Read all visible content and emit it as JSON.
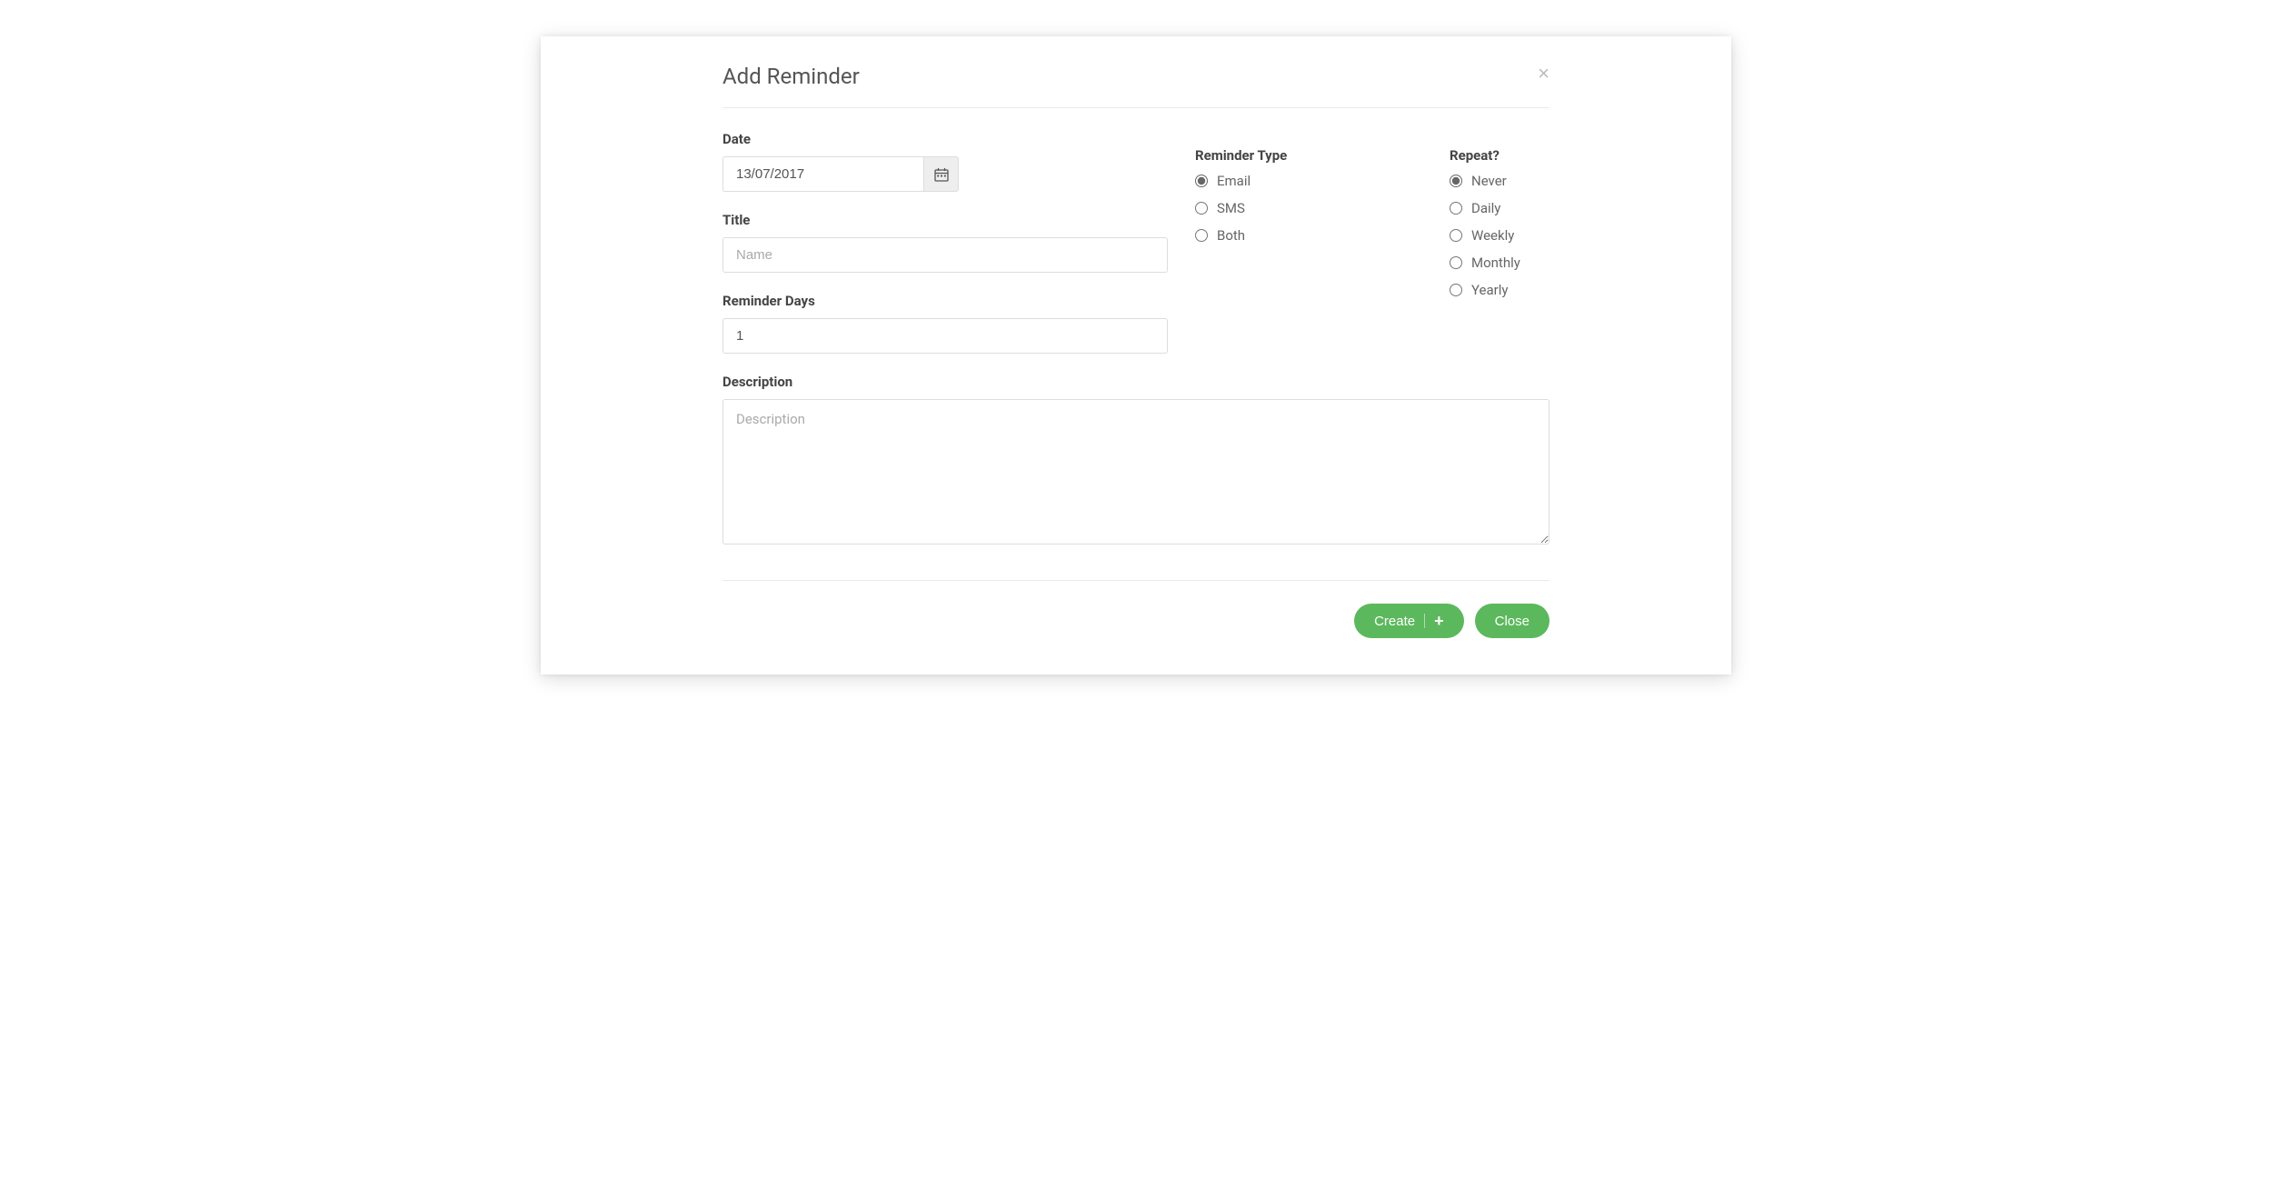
{
  "header": {
    "title": "Add Reminder"
  },
  "form": {
    "date": {
      "label": "Date",
      "value": "13/07/2017"
    },
    "title": {
      "label": "Title",
      "placeholder": "Name",
      "value": ""
    },
    "reminder_days": {
      "label": "Reminder Days",
      "value": "1"
    },
    "description": {
      "label": "Description",
      "placeholder": "Description",
      "value": ""
    },
    "reminder_type": {
      "label": "Reminder Type",
      "options": [
        {
          "label": "Email",
          "selected": true
        },
        {
          "label": "SMS",
          "selected": false
        },
        {
          "label": "Both",
          "selected": false
        }
      ]
    },
    "repeat": {
      "label": "Repeat?",
      "options": [
        {
          "label": "Never",
          "selected": true
        },
        {
          "label": "Daily",
          "selected": false
        },
        {
          "label": "Weekly",
          "selected": false
        },
        {
          "label": "Monthly",
          "selected": false
        },
        {
          "label": "Yearly",
          "selected": false
        }
      ]
    }
  },
  "footer": {
    "create_label": "Create",
    "close_label": "Close"
  }
}
